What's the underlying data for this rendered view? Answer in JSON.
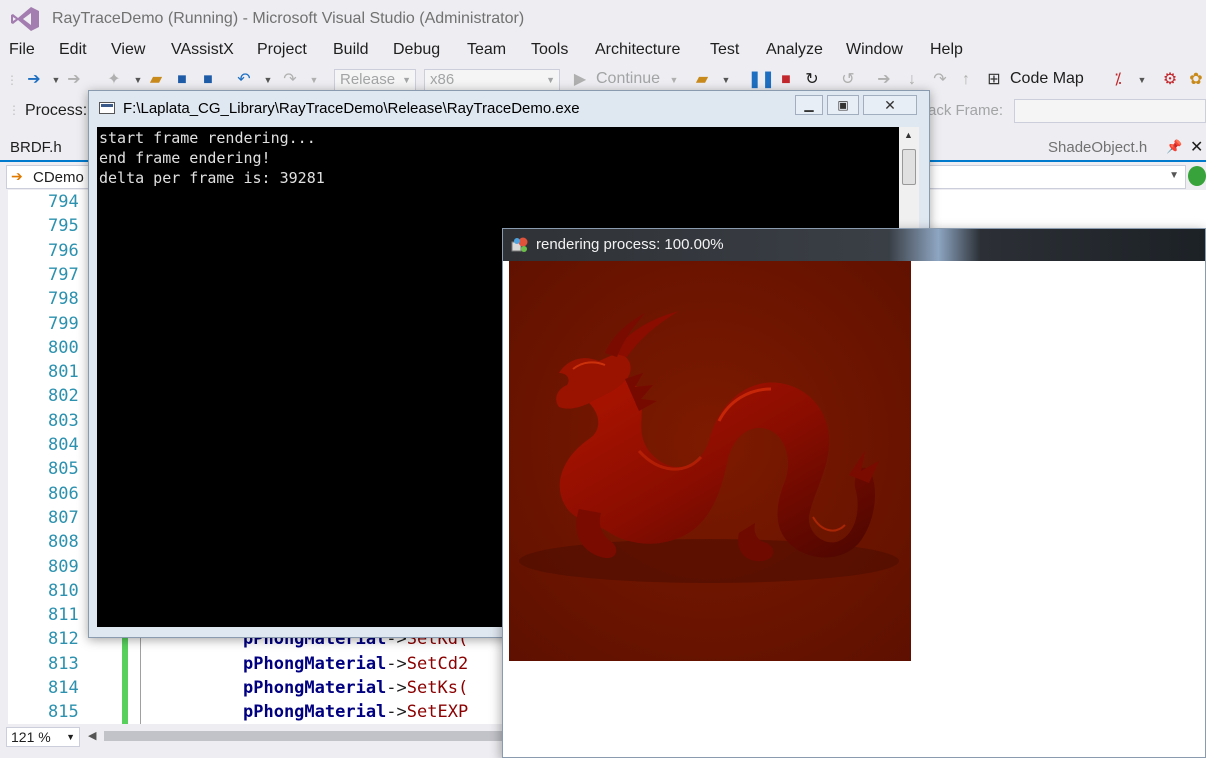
{
  "window": {
    "title": "RayTraceDemo (Running) - Microsoft Visual Studio (Administrator)"
  },
  "menu": [
    "File",
    "Edit",
    "View",
    "VAssistX",
    "Project",
    "Build",
    "Debug",
    "Team",
    "Tools",
    "Architecture",
    "Test",
    "Analyze",
    "Window",
    "Help"
  ],
  "toolbar": {
    "configuration": "Release",
    "platform": "x86",
    "continue_label": "Continue",
    "code_map_label": "Code Map"
  },
  "toolbar2": {
    "process_label": "Process:",
    "stack_frame_label": "ack Frame:"
  },
  "tabs": {
    "left": "BRDF.h",
    "right": "ShadeObject.h"
  },
  "navbar": {
    "scope": "CDemo"
  },
  "editor": {
    "line_numbers": [
      "794",
      "795",
      "796",
      "797",
      "798",
      "799",
      "800",
      "801",
      "802",
      "803",
      "804",
      "805",
      "806",
      "807",
      "808",
      "809",
      "810",
      "811",
      "812",
      "813",
      "814",
      "815"
    ],
    "code": [
      {
        "obj": "pPhongMaterial",
        "op": "->",
        "fn": "SetKd("
      },
      {
        "obj": "pPhongMaterial",
        "op": "->",
        "fn": "SetCd2"
      },
      {
        "obj": "pPhongMaterial",
        "op": "->",
        "fn": "SetKs("
      },
      {
        "obj": "pPhongMaterial",
        "op": "->",
        "fn": "SetEXP"
      }
    ]
  },
  "status": {
    "zoom": "121 %"
  },
  "console": {
    "title": "F:\\Laplata_CG_Library\\RayTraceDemo\\Release\\RayTraceDemo.exe",
    "lines": [
      "start frame rendering...",
      "end frame endering!",
      "delta per frame is: 39281"
    ]
  },
  "render_window": {
    "title": "rendering process: 100.00%",
    "progress_percent": 100
  },
  "colors": {
    "accent": "#007acc",
    "line_number": "#2b91af",
    "render_background": "#6e1400"
  }
}
